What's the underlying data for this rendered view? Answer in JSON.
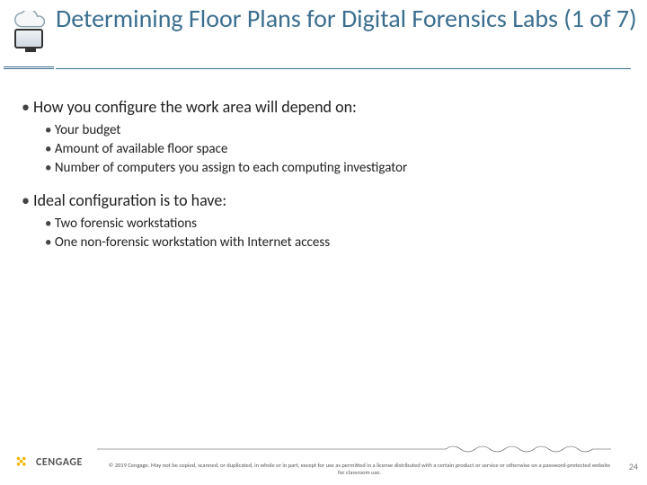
{
  "title": "Determining Floor Plans for Digital Forensics Labs (1 of 7)",
  "bullets": [
    {
      "text": "How you configure the work area will depend on:",
      "children": [
        "Your budget",
        "Amount of available floor space",
        "Number of computers you assign to each computing investigator"
      ]
    },
    {
      "text": "Ideal configuration is to have:",
      "children": [
        "Two forensic workstations",
        "One non-forensic workstation with Internet access"
      ]
    }
  ],
  "brand": "CENGAGE",
  "copyright": "© 2019 Cengage. May not be copied, scanned, or duplicated, in whole or in part, except for use as permitted in a license distributed with a certain product or service or otherwise on a password-protected website for classroom use.",
  "page_number": "24",
  "icons": {
    "head": "cloud-monitor-icon",
    "brand": "cengage-mark-icon"
  }
}
